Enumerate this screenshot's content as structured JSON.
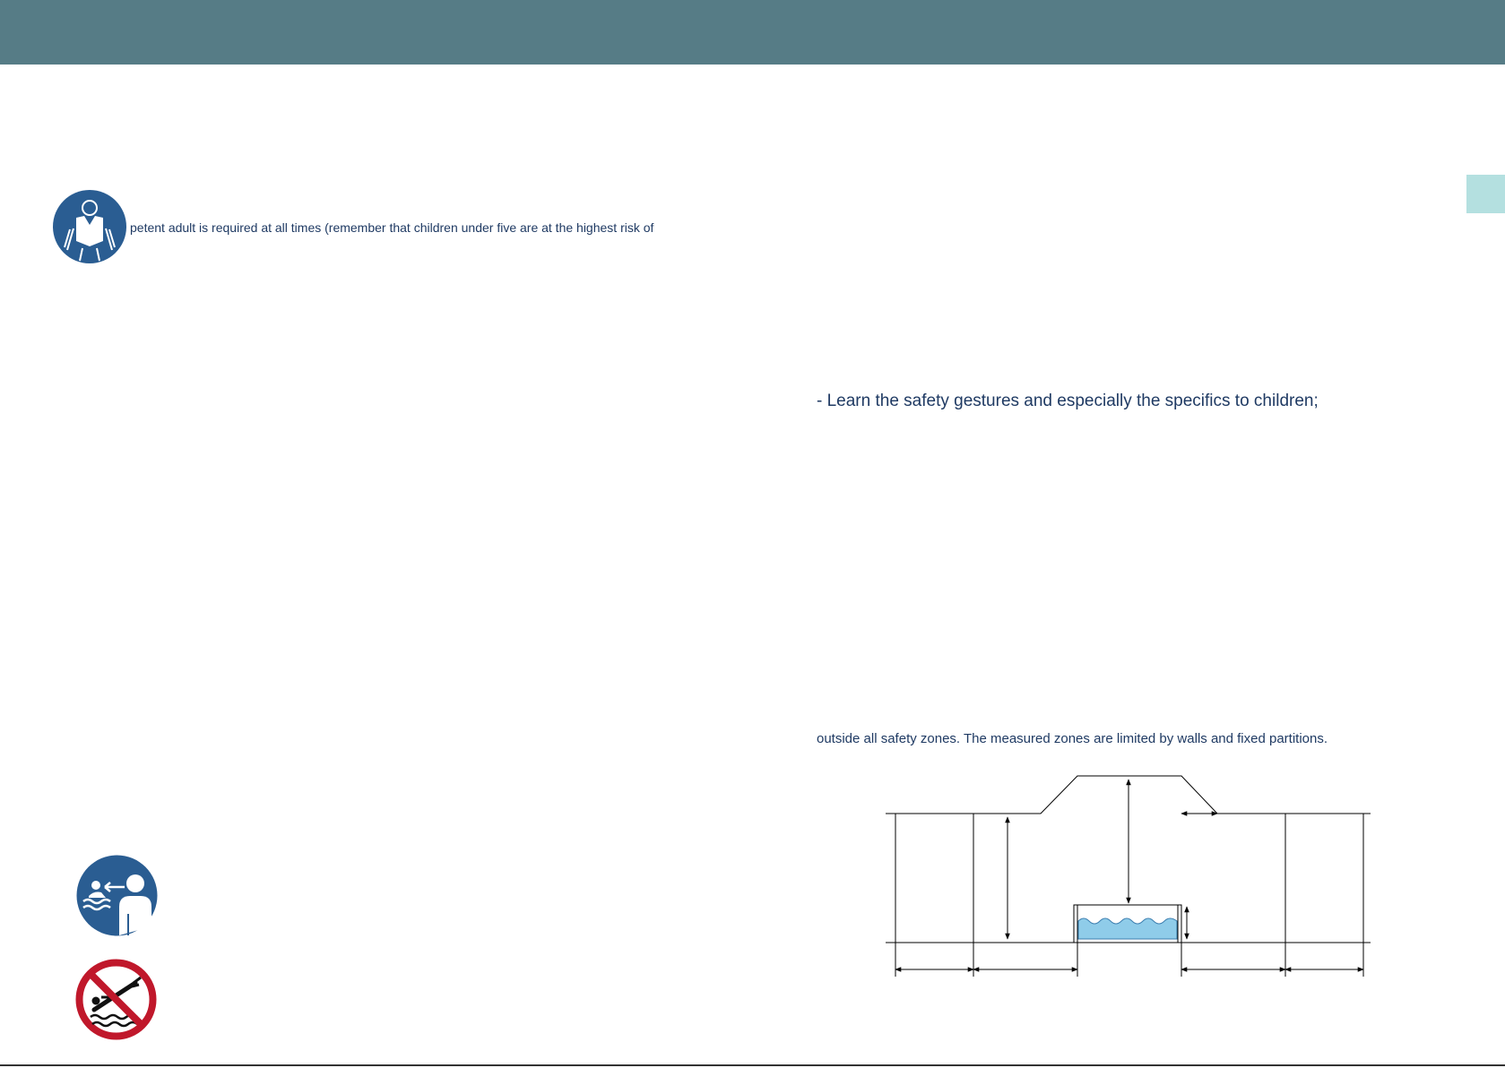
{
  "header": {
    "color": "#567c86"
  },
  "side_tab": {
    "color": "#b4e0e0"
  },
  "icons": {
    "lifejacket": "life-jacket-icon",
    "supervise": "supervise-children-icon",
    "no_diving": "no-diving-icon",
    "mandatory_color": "#2a5d92",
    "prohibition_color": "#c0182b"
  },
  "text": {
    "supervision_line": "petent adult is required at all times (remember that children under five are at the highest risk of",
    "gestures_bullet": "- Learn the safety gestures and especially the specifics to children;",
    "zones_line": "outside all safety zones. The measured zones are limited by walls and fixed partitions."
  },
  "diagram": {
    "water_color": "#8fcce9"
  }
}
